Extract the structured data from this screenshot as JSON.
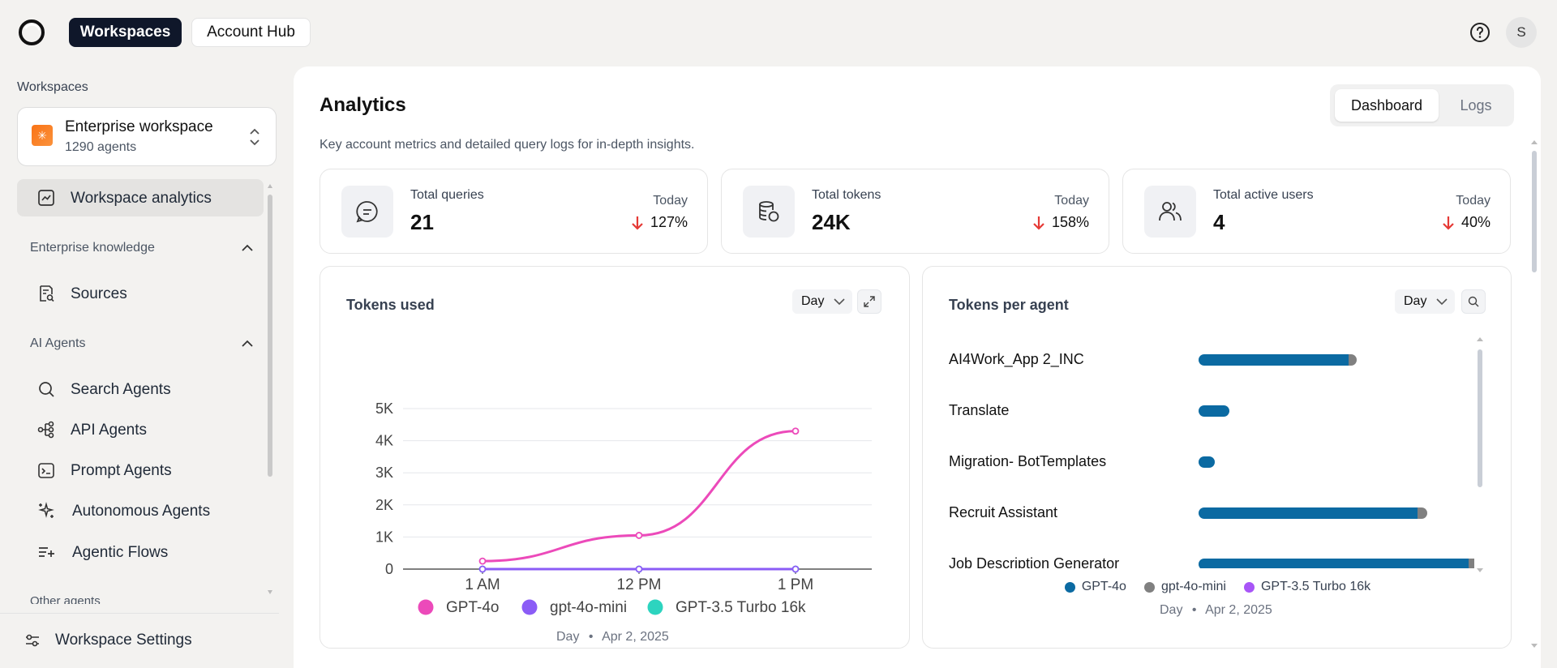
{
  "topbar": {
    "tabs": [
      "Workspaces",
      "Account Hub"
    ],
    "avatar_initial": "S"
  },
  "sidebar": {
    "section_label": "Workspaces",
    "workspace": {
      "name": "Enterprise workspace",
      "agents": "1290 agents"
    },
    "analytics_item": "Workspace analytics",
    "knowledge_heading": "Enterprise knowledge",
    "sources_item": "Sources",
    "ai_heading": "AI Agents",
    "agents": [
      "Search Agents",
      "API Agents",
      "Prompt Agents",
      "Autonomous Agents",
      "Agentic Flows"
    ],
    "other_heading": "Other agents",
    "settings": "Workspace Settings"
  },
  "main": {
    "title": "Analytics",
    "subtitle": "Key account metrics and detailed query logs for in-depth insights.",
    "view_toggle": [
      "Dashboard",
      "Logs"
    ],
    "stats": [
      {
        "label": "Total queries",
        "value": "21",
        "period": "Today",
        "change": "127%",
        "direction": "down"
      },
      {
        "label": "Total tokens",
        "value": "24K",
        "period": "Today",
        "change": "158%",
        "direction": "down"
      },
      {
        "label": "Total active users",
        "value": "4",
        "period": "Today",
        "change": "40%",
        "direction": "down"
      }
    ],
    "tokens_used": {
      "title": "Tokens used",
      "period_select": "Day",
      "footer_period": "Day",
      "footer_date": "Apr 2, 2025"
    },
    "tokens_per_agent": {
      "title": "Tokens per agent",
      "period_select": "Day",
      "footer_period": "Day",
      "footer_date": "Apr 2, 2025"
    }
  },
  "colors": {
    "gpt4o_line": "#ec4aba",
    "gpt4omini_line": "#8b5cf6",
    "gpt35_line": "#2dd4bf",
    "bar_gpt4o": "#0b6aa2",
    "bar_gpt4omini": "#808080",
    "bar_gpt35": "#a855f7",
    "down_arrow": "#e53935"
  },
  "chart_data": [
    {
      "type": "line",
      "title": "Tokens used",
      "categories": [
        "1 AM",
        "12 PM",
        "1 PM"
      ],
      "yticks": [
        "0",
        "1K",
        "2K",
        "3K",
        "4K",
        "5K"
      ],
      "ylim": [
        0,
        5000
      ],
      "series": [
        {
          "name": "GPT-4o",
          "color": "#ec4aba",
          "values": [
            250,
            1050,
            4300
          ]
        },
        {
          "name": "gpt-4o-mini",
          "color": "#8b5cf6",
          "values": [
            0,
            0,
            0
          ]
        },
        {
          "name": "GPT-3.5 Turbo 16k",
          "color": "#2dd4bf",
          "values": [
            0,
            0,
            0
          ]
        }
      ],
      "legend_position": "bottom",
      "grid": true
    },
    {
      "type": "bar",
      "orientation": "horizontal",
      "stacked": true,
      "title": "Tokens per agent",
      "categories": [
        "AI4Work_App 2_INC",
        "Translate",
        "Migration- BotTemplates",
        "Recruit Assistant",
        "Job Description Generator"
      ],
      "series": [
        {
          "name": "GPT-4o",
          "color": "#0b6aa2",
          "values": [
            185,
            38,
            20,
            270,
            333
          ]
        },
        {
          "name": "gpt-4o-mini",
          "color": "#808080",
          "values": [
            10,
            0,
            0,
            12,
            13
          ]
        },
        {
          "name": "GPT-3.5 Turbo 16k",
          "color": "#a855f7",
          "values": [
            0,
            0,
            0,
            0,
            22
          ]
        }
      ],
      "legend_position": "bottom"
    }
  ]
}
